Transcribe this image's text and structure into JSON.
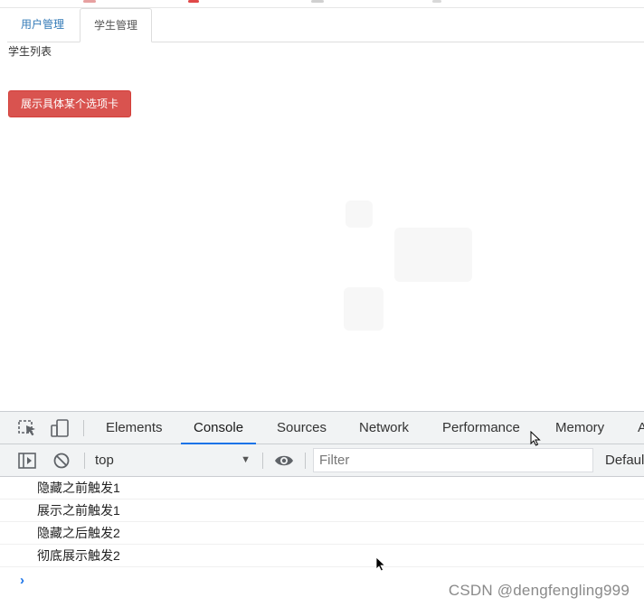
{
  "page": {
    "tabs": [
      {
        "label": "用户管理",
        "active": false
      },
      {
        "label": "学生管理",
        "active": true
      }
    ],
    "active_content": "学生列表",
    "show_tab_button": "展示具体某个选项卡"
  },
  "devtools": {
    "tabs": [
      {
        "label": "Elements",
        "active": false
      },
      {
        "label": "Console",
        "active": true
      },
      {
        "label": "Sources",
        "active": false
      },
      {
        "label": "Network",
        "active": false
      },
      {
        "label": "Performance",
        "active": false
      },
      {
        "label": "Memory",
        "active": false
      },
      {
        "label": "A",
        "active": false
      }
    ],
    "context": "top",
    "filter_placeholder": "Filter",
    "levels_label": "Defaul",
    "logs": [
      "隐藏之前触发1",
      "展示之前触发1",
      "隐藏之后触发2",
      "彻底展示触发2"
    ]
  },
  "watermark": "CSDN @dengfengling999",
  "colors": {
    "danger": "#d9534f",
    "link": "#337ab7",
    "devtools_accent": "#1a73e8"
  }
}
